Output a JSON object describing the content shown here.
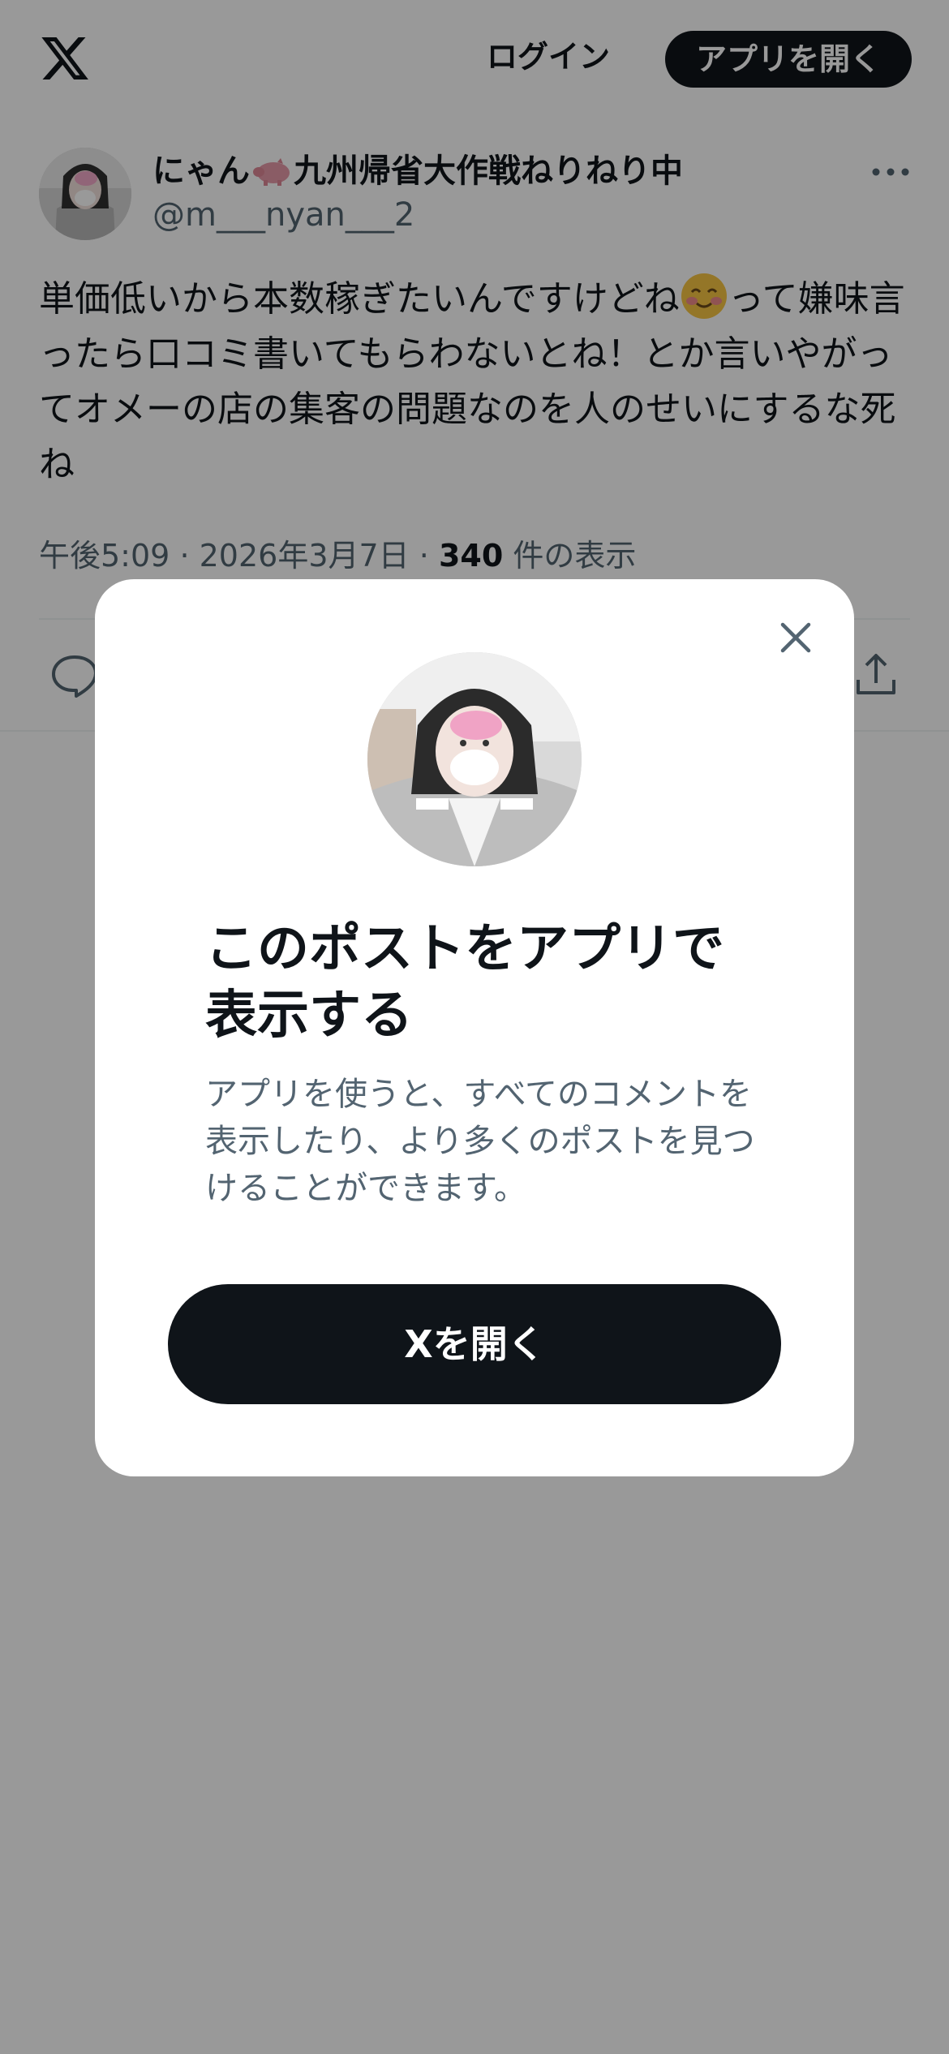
{
  "header": {
    "logo_icon": "x-logo-icon",
    "login_label": "ログイン",
    "open_app_label": "アプリを開く"
  },
  "post": {
    "display_name_part1": "にゃん",
    "display_name_emoji": "pig-icon",
    "display_name_part2": "九州帰省大作戦ねりねり中",
    "handle": "@m___nyan___2",
    "text_part1": "単価低いから本数稼ぎたいんですけどね",
    "text_emoji": "smiling-face-icon",
    "text_part2": "って嫌味言ったら口コミ書いてもらわないとね！とか言いやがってオメーの店の集客の問題なのを人のせいにするな死ね",
    "time": "午後5:09",
    "separator": "·",
    "date": "2026年3月7日",
    "views_count": "340",
    "views_label": "件の表示"
  },
  "modal": {
    "title": "このポストをアプリで表示する",
    "description": "アプリを使うと、すべてのコメントを表示したり、より多くのポストを見つけることができます。",
    "open_button_label": "Xを開く"
  },
  "colors": {
    "primary_text": "#0f1419",
    "secondary_text": "#536471",
    "button_bg": "#0f1419",
    "overlay": "rgba(0,0,0,0.40)"
  }
}
